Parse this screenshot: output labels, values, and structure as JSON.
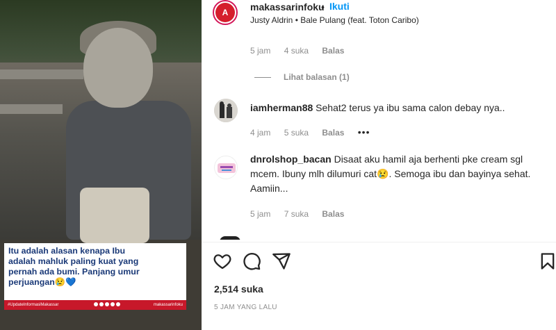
{
  "post": {
    "username": "makassarinfoku",
    "separator": "•",
    "follow_label": "Ikuti",
    "music": "Justy Aldrin • Bale Pulang (feat. Toton Caribo)",
    "avatar_letter": "A"
  },
  "media": {
    "caption": "Itu adalah alasan kenapa Ibu\nadalah mahluk paling kuat yang\npernah ada bumi. Panjang umur\nperjuangan😢💙",
    "footer_tag": "#UpdateInformasiMakassar",
    "footer_brand": "makassarinfoku"
  },
  "comments": {
    "prev_meta": {
      "time": "5 jam",
      "likes": "4 suka",
      "reply": "Balas"
    },
    "view_replies": "Lihat balasan (1)",
    "items": [
      {
        "username": "iamherman88",
        "text": "Sehat2 terus ya ibu sama calon debay nya..",
        "time": "4 jam",
        "likes": "5 suka",
        "reply": "Balas",
        "more": "•••"
      },
      {
        "username": "dnrolshop_bacan",
        "text": "Disaat aku hamil aja berhenti pke cream sgl mcem. Ibuny mlh dilumuri cat😢. Semoga ibu dan bayinya sehat. Aamiin...",
        "time": "5 jam",
        "likes": "7 suka",
        "reply": "Balas"
      }
    ]
  },
  "footer": {
    "likes": "2,514 suka",
    "time": "5 JAM YANG LALU"
  },
  "colors": {
    "accent": "#0095f6",
    "brand_red": "#d51e2c",
    "muted": "#8e8e8e",
    "text": "#262626",
    "caption_blue": "#1b3a78"
  }
}
